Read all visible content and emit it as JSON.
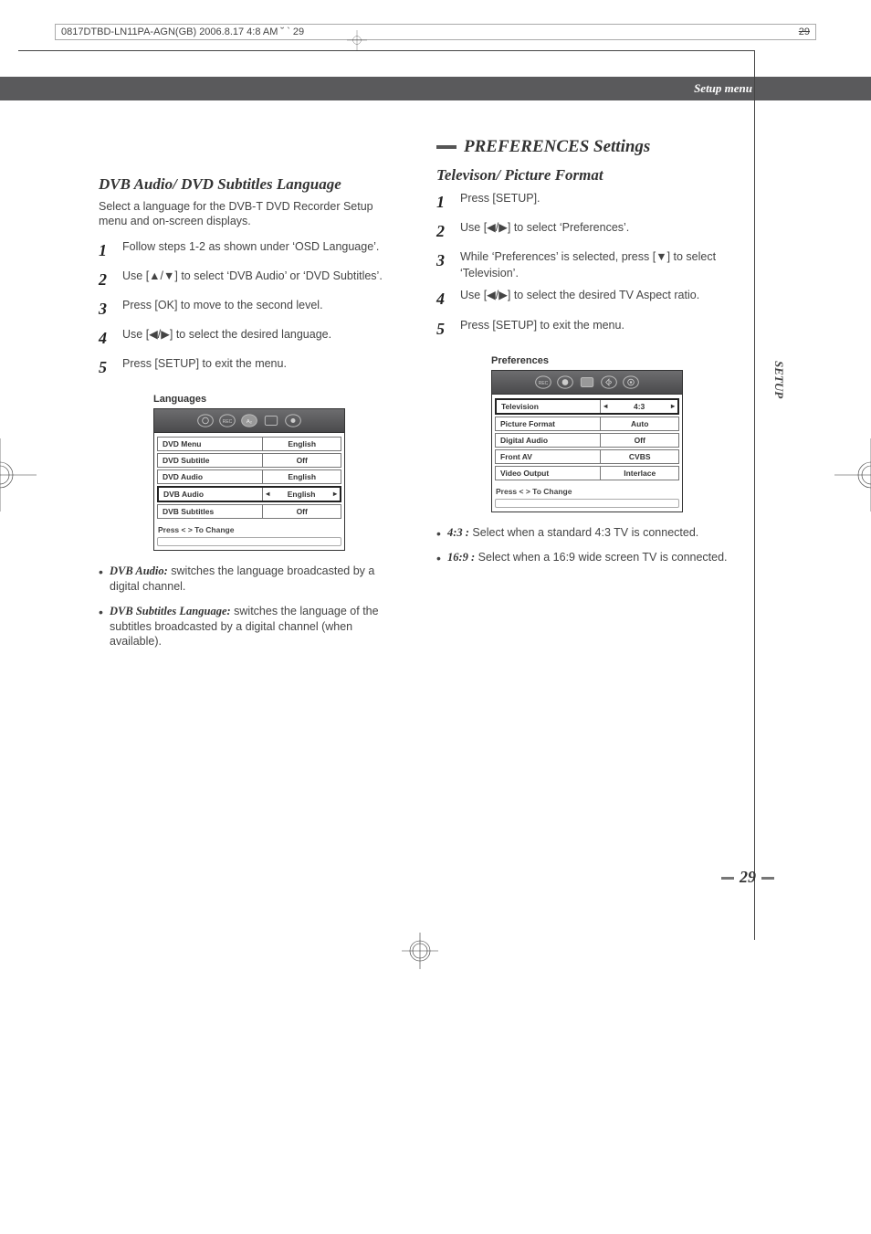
{
  "header": {
    "file": "0817DTBD-LN11PA-AGN(GB)  2006.8.17 4:8 AM  ˘ ` 29",
    "pg": "29"
  },
  "band_title": "Setup menu",
  "side_tab": "SETUP",
  "page_number": "29",
  "left": {
    "heading": "DVB Audio/ DVD Subtitles Language",
    "intro": "Select a language for the DVB-T DVD Recorder Setup menu and on-screen displays.",
    "steps": [
      "Follow steps 1-2 as shown under ‘OSD Language’.",
      "Use [▲/▼] to select ‘DVB Audio’ or ‘DVD Subtitles’.",
      "Press [OK] to move to the second level.",
      "Use [◀/▶] to select the desired language.",
      "Press [SETUP] to exit the menu."
    ],
    "osd": {
      "title": "Languages",
      "rows": [
        {
          "label": "DVD Menu",
          "value": "English",
          "sel": false
        },
        {
          "label": "DVD Subtitle",
          "value": "Off",
          "sel": false
        },
        {
          "label": "DVD Audio",
          "value": "English",
          "sel": false
        },
        {
          "label": "DVB Audio",
          "value": "English",
          "sel": true
        },
        {
          "label": "DVB Subtitles",
          "value": "Off",
          "sel": false
        }
      ],
      "hint": "Press < >  To Change"
    },
    "bullets": [
      {
        "term": "DVB Audio:",
        "text": " switches the language broadcasted by a digital channel."
      },
      {
        "term": "DVB Subtitles Language:",
        "text": " switches the language of the subtitles broadcasted by a digital channel (when available)."
      }
    ]
  },
  "right": {
    "main_heading": "PREFERENCES Settings",
    "heading": "Televison/ Picture Format",
    "steps": [
      "Press [SETUP].",
      "Use [◀/▶] to select ‘Preferences’.",
      "While ‘Preferences’ is selected, press [▼] to select ‘Television’.",
      "Use [◀/▶] to select the desired TV Aspect ratio.",
      "Press [SETUP] to exit the menu."
    ],
    "osd": {
      "title": "Preferences",
      "rows": [
        {
          "label": "Television",
          "value": "4:3",
          "sel": true
        },
        {
          "label": "Picture Format",
          "value": "Auto",
          "sel": false
        },
        {
          "label": "Digital Audio",
          "value": "Off",
          "sel": false
        },
        {
          "label": "Front AV",
          "value": "CVBS",
          "sel": false
        },
        {
          "label": "Video Output",
          "value": "Interlace",
          "sel": false
        }
      ],
      "hint": "Press < >  To Change"
    },
    "bullets": [
      {
        "term": "4:3 :",
        "text": "  Select when a standard 4:3 TV is connected."
      },
      {
        "term": "16:9 :",
        "text": "  Select when a 16:9 wide screen TV is connected."
      }
    ]
  }
}
